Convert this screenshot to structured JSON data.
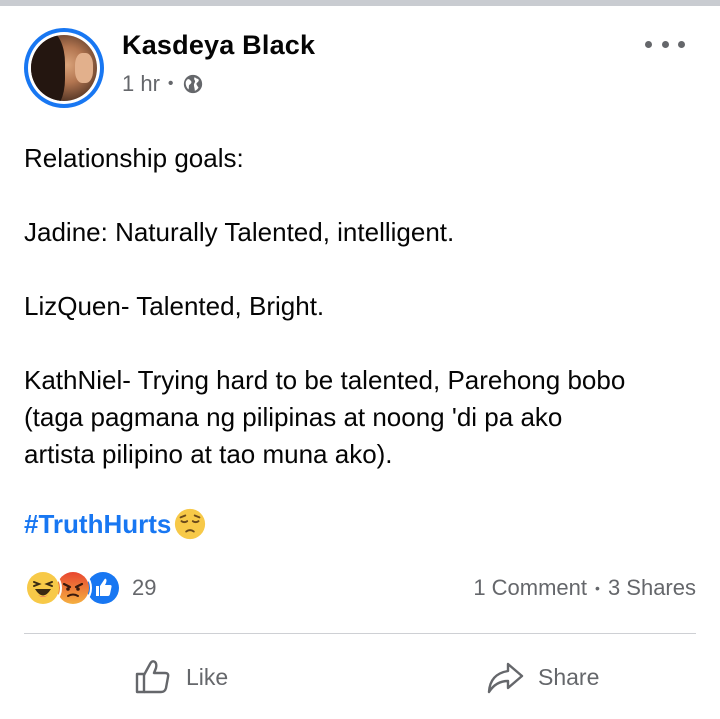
{
  "post": {
    "author": "Kasdeya Black",
    "time": "1 hr",
    "separator": "•",
    "privacy_icon": "globe-icon",
    "more_icon": "more-options-icon",
    "lines": [
      "Relationship goals:",
      "Jadine: Naturally Talented, intelligent.",
      "LizQuen- Talented, Bright.",
      "KathNiel- Trying hard to be talented, Parehong bobo",
      "(taga pagmana ng pilipinas at noong 'di pa ako",
      "artista pilipino at tao muna ako)."
    ],
    "hashtag": "#TruthHurts",
    "hashtag_emoji": "pensive-face"
  },
  "reactions": {
    "icons": [
      "haha-icon",
      "angry-icon",
      "like-icon"
    ],
    "count": "29",
    "comments": "1 Comment",
    "dot": "•",
    "shares": "3 Shares"
  },
  "actions": {
    "like_label": "Like",
    "share_label": "Share"
  },
  "colors": {
    "accent": "#1877f2",
    "secondary_text": "#65676b",
    "divider": "#ced0d4"
  }
}
